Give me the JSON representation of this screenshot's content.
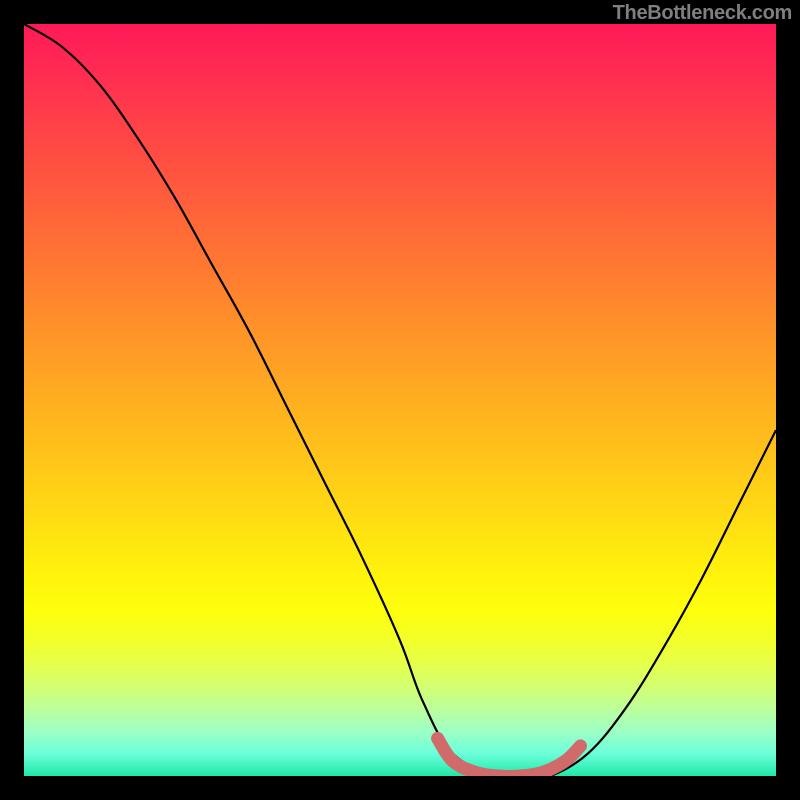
{
  "attribution": "TheBottleneck.com",
  "chart_data": {
    "type": "line",
    "title": "",
    "xlabel": "",
    "ylabel": "",
    "xlim": [
      0,
      100
    ],
    "ylim": [
      0,
      100
    ],
    "series": [
      {
        "name": "bottleneck-curve",
        "x": [
          0,
          5,
          10,
          15,
          20,
          25,
          30,
          35,
          40,
          45,
          50,
          53,
          57,
          63,
          67,
          70,
          75,
          80,
          85,
          90,
          95,
          100
        ],
        "y": [
          100,
          97,
          92,
          85,
          77,
          68,
          59,
          49,
          39,
          29,
          18,
          10,
          3,
          0,
          0,
          0,
          3,
          9,
          17,
          26,
          36,
          46
        ]
      },
      {
        "name": "optimal-range-highlight",
        "x": [
          55,
          57,
          60,
          63,
          66,
          69,
          72,
          74
        ],
        "y": [
          5,
          2,
          0.5,
          0,
          0,
          0.5,
          2,
          4
        ]
      }
    ],
    "colors": {
      "curve": "#000000",
      "highlight": "#d16a6a",
      "gradient_top": "#ff1a58",
      "gradient_bottom": "#20e8a8"
    }
  }
}
